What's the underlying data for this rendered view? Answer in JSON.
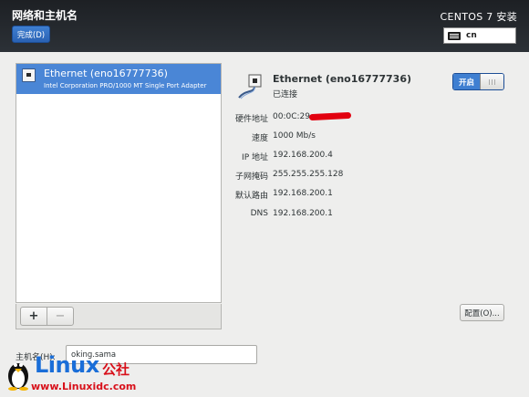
{
  "header": {
    "title": "网络和主机名",
    "done_label": "完成(D)",
    "product": "CENTOS 7 安装",
    "keyboard_layout": "cn"
  },
  "connections": [
    {
      "name": "Ethernet (eno16777736)",
      "description": "Intel Corporation PRO/1000 MT Single Port Adapter",
      "selected": true
    }
  ],
  "list_toolbar": {
    "add_label": "+",
    "remove_label": "−"
  },
  "details": {
    "name": "Ethernet (eno16777736)",
    "status": "已连接",
    "toggle_label": "开启",
    "toggle_state": "on",
    "properties": [
      {
        "label": "硬件地址",
        "value": "00:0C:29:"
      },
      {
        "label": "速度",
        "value": "1000 Mb/s"
      },
      {
        "label": "IP 地址",
        "value": "192.168.200.4"
      },
      {
        "label": "子网掩码",
        "value": "255.255.255.128"
      },
      {
        "label": "默认路由",
        "value": "192.168.200.1"
      },
      {
        "label": "DNS",
        "value": "192.168.200.1"
      }
    ],
    "configure_label": "配置(O)..."
  },
  "hostname": {
    "label": "主机名(H):",
    "value": "oking.sama"
  },
  "watermark": {
    "brand": "Linux",
    "brand_cn": "公社",
    "url": "www.Linuxidc.com"
  },
  "colors": {
    "accent": "#3f7fd1",
    "selection": "#4a86d6",
    "redaction": "#e2000f",
    "watermark_blue": "#1a6ed8",
    "watermark_red": "#d8101a"
  }
}
